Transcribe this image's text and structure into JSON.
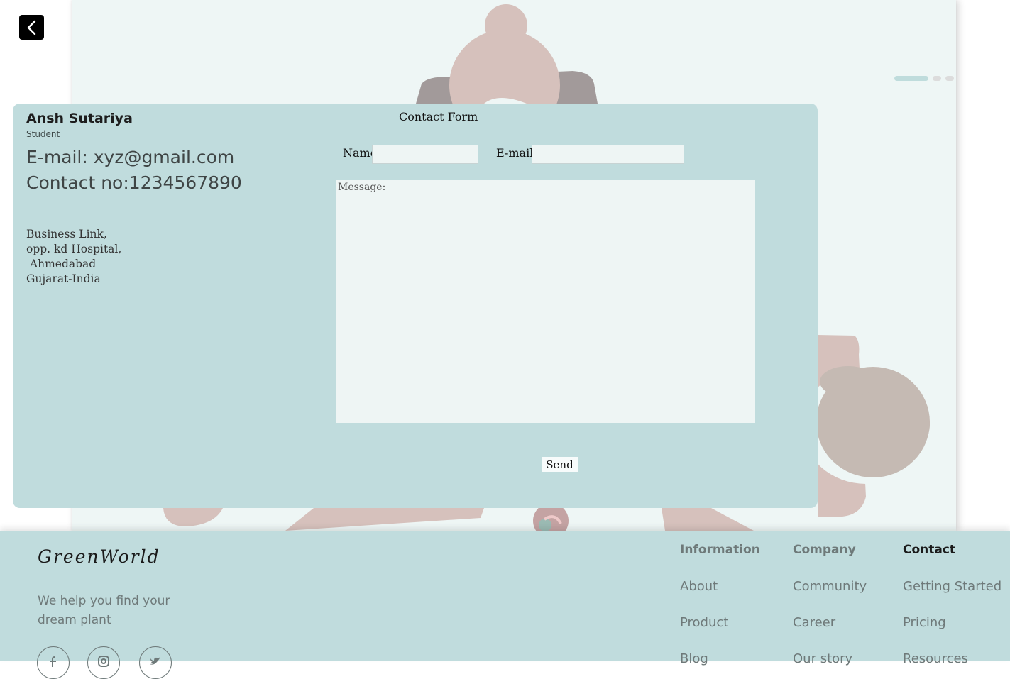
{
  "nav": {
    "back_icon": "chevron-left-icon"
  },
  "carousel": {
    "slides": 3,
    "active": 1
  },
  "profile": {
    "name": "Ansh Sutariya",
    "role": "Student",
    "email": "E-mail: xyz@gmail.com",
    "phone": "Contact no:1234567890",
    "address": [
      "Business Link,",
      "opp. kd Hospital,",
      " Ahmedabad",
      "Gujarat-India"
    ]
  },
  "form": {
    "title": "Contact Form",
    "name_label": "Name",
    "name_value": "",
    "email_label": "E-mail",
    "email_value": "",
    "message_placeholder": "Message:",
    "send_label": "Send"
  },
  "footer": {
    "brand": "GreenWorld",
    "tagline": "We help you find your dream plant",
    "social_icons": [
      "facebook-icon",
      "instagram-icon",
      "twitter-icon"
    ],
    "columns": [
      {
        "heading": "Information",
        "links": [
          "About",
          "Product",
          "Blog"
        ]
      },
      {
        "heading": "Company",
        "links": [
          "Community",
          "Career",
          "Our story"
        ]
      },
      {
        "heading": "Contact",
        "links": [
          "Getting Started",
          "Pricing",
          "Resources"
        ]
      }
    ]
  },
  "colors": {
    "card_bg": "#c0dcdd",
    "hero_bg": "#eef6f5",
    "muted_text": "#6e7979",
    "dark_text": "#1a1a1a"
  }
}
